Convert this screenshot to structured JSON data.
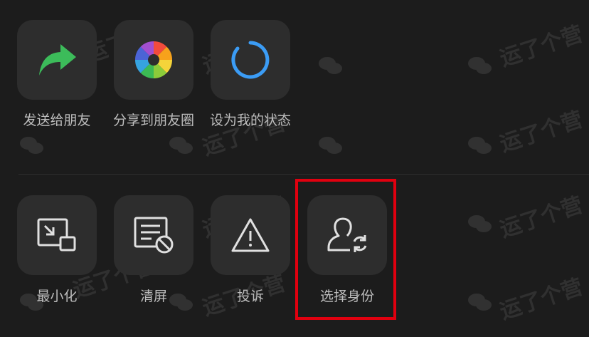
{
  "share_row": {
    "items": [
      {
        "label": "发送给朋友"
      },
      {
        "label": "分享到朋友圈"
      },
      {
        "label": "设为我的状态"
      }
    ]
  },
  "action_row": {
    "items": [
      {
        "label": "最小化"
      },
      {
        "label": "清屏"
      },
      {
        "label": "投诉"
      },
      {
        "label": "选择身份"
      }
    ]
  },
  "watermark": {
    "text": "运了个营"
  },
  "highlight_color": "#e0000f"
}
